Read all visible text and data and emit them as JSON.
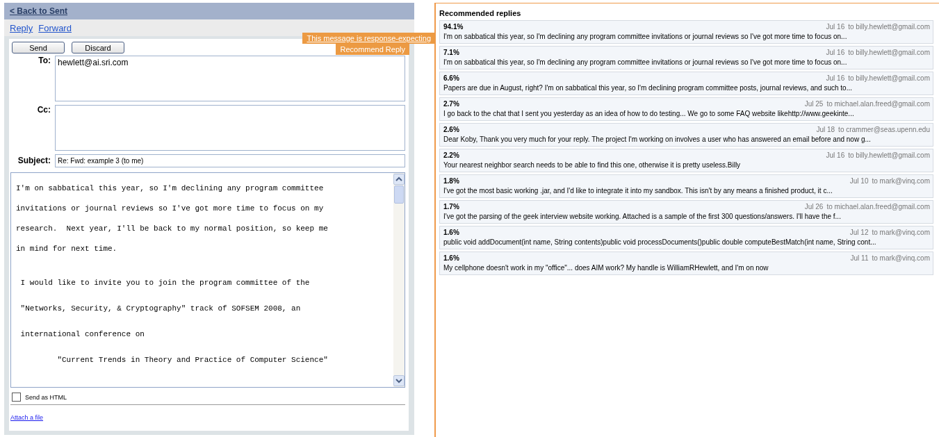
{
  "back_link": "< Back to Sent",
  "actions": [
    "Reply",
    "Forward"
  ],
  "notice": {
    "text": "This message is response-expecting",
    "button": "Recommend Reply"
  },
  "compose": {
    "buttons": [
      "Send",
      "Discard"
    ],
    "to": {
      "label": "To:",
      "value": "hewlett@ai.sri.com"
    },
    "cc": {
      "label": "Cc:"
    },
    "subject": {
      "label": "Subject:",
      "value": "Re: Fwd: example 3 (to me)"
    },
    "body_paragraphs": [
      [
        "I'm on sabbatical this year, so I'm declining any program committee",
        "invitations or journal reviews so I've got more time to focus on my",
        "research.  Next year, I'll be back to my normal position, so keep me",
        "in mind for next time."
      ],
      [
        " I would like to invite you to join the program committee of the",
        " \"Networks, Security, & Cryptography\" track of SOFSEM 2008, an",
        " international conference on",
        "         \"Current Trends in Theory and Practice of Computer Science\""
      ]
    ],
    "send_as_html": {
      "label": "Send as HTML",
      "checked": false
    },
    "attach": "Attach a file"
  },
  "recommended": {
    "title": "Recommended replies",
    "items": [
      {
        "score": "94.1%",
        "date": "Jul 16",
        "to": "to billy.hewlett@gmail.com",
        "snippet": "I'm on sabbatical this year, so I'm declining any program committee invitations or journal reviews so I've got more time to focus on..."
      },
      {
        "score": "7.1%",
        "date": "Jul 16",
        "to": "to billy.hewlett@gmail.com",
        "snippet": "I'm on sabbatical this year, so I'm declining any program committee invitations or journal reviews so I've got more time to focus on..."
      },
      {
        "score": "6.6%",
        "date": "Jul 16",
        "to": "to billy.hewlett@gmail.com",
        "snippet": "Papers are due in August, right? I'm on sabbatical this year, so I'm declining program committee posts, journal reviews, and such to..."
      },
      {
        "score": "2.7%",
        "date": "Jul 25",
        "to": "to michael.alan.freed@gmail.com",
        "snippet": "I go back to the chat that I sent you yesterday as an idea of how to do testing... We go to some FAQ website likehttp://www.geekinte..."
      },
      {
        "score": "2.6%",
        "date": "Jul 18",
        "to": "to crammer@seas.upenn.edu",
        "snippet": "Dear Koby, Thank you very much for your reply. The project I'm working on involves a user who has answered an email before and now g..."
      },
      {
        "score": "2.2%",
        "date": "Jul 16",
        "to": "to billy.hewlett@gmail.com",
        "snippet": "Your nearest neighbor search needs to be able to find this one, otherwise it is pretty useless.Billy"
      },
      {
        "score": "1.8%",
        "date": "Jul 10",
        "to": "to mark@vinq.com",
        "snippet": "I've got the most basic working .jar, and I'd like to integrate it into my sandbox. This isn't by any means a finished product, it c..."
      },
      {
        "score": "1.7%",
        "date": "Jul 26",
        "to": "to michael.alan.freed@gmail.com",
        "snippet": "I've got the parsing of the geek interview website working. Attached is a sample of the first 300 questions/answers. I'll have the f..."
      },
      {
        "score": "1.6%",
        "date": "Jul 12",
        "to": "to mark@vinq.com",
        "snippet": "public void addDocument(int name, String contents)public void processDocuments()public double computeBestMatch(int name, String cont..."
      },
      {
        "score": "1.6%",
        "date": "Jul 11",
        "to": "to mark@vinq.com",
        "snippet": "My cellphone doesn't work in my \"office\"... does AIM work? My handle is WilliamRHewlett, and I'm on now"
      }
    ]
  }
}
